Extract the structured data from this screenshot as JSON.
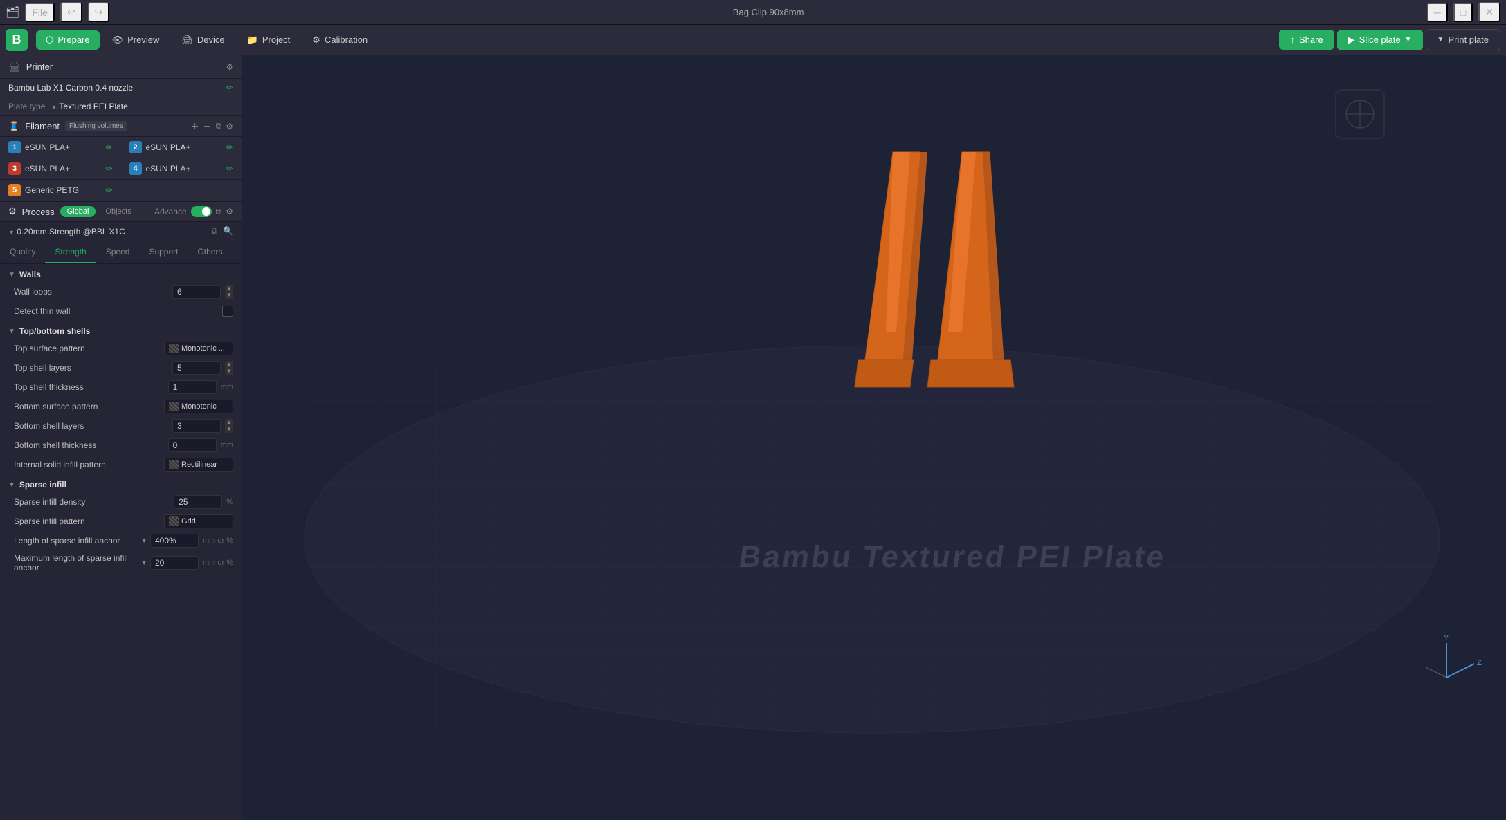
{
  "titlebar": {
    "title": "Bag Clip 90x8mm",
    "file_menu": "File",
    "min_label": "─",
    "max_label": "□",
    "close_label": "✕"
  },
  "topnav": {
    "prepare_label": "Prepare",
    "preview_label": "Preview",
    "device_label": "Device",
    "project_label": "Project",
    "calibration_label": "Calibration",
    "share_label": "Share",
    "slice_label": "Slice plate",
    "print_label": "Print plate"
  },
  "printer": {
    "section_label": "Printer",
    "name": "Bambu Lab X1 Carbon 0.4 nozzle",
    "plate_type_label": "Plate type",
    "plate_type_value": "Textured PEI Plate"
  },
  "filament": {
    "section_label": "Filament",
    "flushing_label": "Flushing volumes",
    "items": [
      {
        "num": "1",
        "color": "#2980b9",
        "name": "eSUN PLA+"
      },
      {
        "num": "2",
        "color": "#2980b9",
        "name": "eSUN PLA+"
      },
      {
        "num": "3",
        "color": "#c0392b",
        "name": "eSUN PLA+"
      },
      {
        "num": "4",
        "color": "#2980b9",
        "name": "eSUN PLA+"
      },
      {
        "num": "5",
        "color": "#e67e22",
        "name": "Generic PETG"
      }
    ]
  },
  "process": {
    "section_label": "Process",
    "tab_global": "Global",
    "tab_objects": "Objects",
    "advance_label": "Advance",
    "preset_name": "0.20mm Strength @BBL X1C",
    "tabs": {
      "quality": "Quality",
      "strength": "Strength",
      "speed": "Speed",
      "support": "Support",
      "others": "Others"
    },
    "active_tab": "Strength"
  },
  "settings": {
    "walls_group": "Walls",
    "wall_loops_label": "Wall loops",
    "wall_loops_value": "6",
    "detect_thin_wall_label": "Detect thin wall",
    "top_bottom_group": "Top/bottom shells",
    "top_surface_pattern_label": "Top surface pattern",
    "top_surface_pattern_value": "Monotonic ...",
    "top_shell_layers_label": "Top shell layers",
    "top_shell_layers_value": "5",
    "top_shell_thickness_label": "Top shell thickness",
    "top_shell_thickness_value": "1",
    "top_shell_thickness_unit": "mm",
    "bottom_surface_pattern_label": "Bottom surface pattern",
    "bottom_surface_pattern_value": "Monotonic",
    "bottom_shell_layers_label": "Bottom shell layers",
    "bottom_shell_layers_value": "3",
    "bottom_shell_thickness_label": "Bottom shell thickness",
    "bottom_shell_thickness_value": "0",
    "bottom_shell_thickness_unit": "mm",
    "internal_solid_infill_label": "Internal solid infill pattern",
    "internal_solid_infill_value": "Rectilinear",
    "sparse_infill_group": "Sparse infill",
    "sparse_density_label": "Sparse infill density",
    "sparse_density_value": "25",
    "sparse_density_unit": "%",
    "sparse_pattern_label": "Sparse infill pattern",
    "sparse_pattern_value": "Grid",
    "anchor_length_label": "Length of sparse infill anchor",
    "anchor_length_value": "400%",
    "anchor_length_unit": "mm or %",
    "max_anchor_label": "Maximum length of sparse infill anchor",
    "max_anchor_value": "20",
    "max_anchor_unit": "mm or %"
  },
  "viewport": {
    "plate_text": "Bambu Textured PEI Plate"
  }
}
